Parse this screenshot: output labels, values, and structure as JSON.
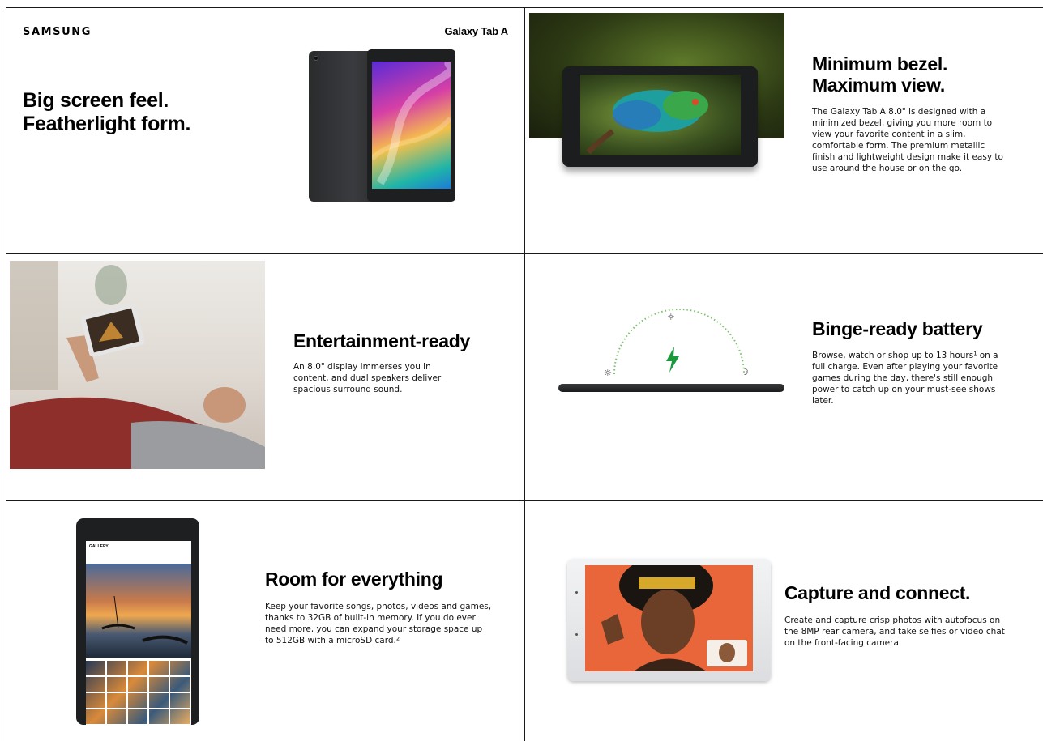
{
  "hero": {
    "brand": "SAMSUNG",
    "model": "Galaxy Tab A",
    "headline_line1": "Big screen feel.",
    "headline_line2": "Featherlight form."
  },
  "bezel": {
    "headline_line1": "Minimum bezel.",
    "headline_line2": "Maximum view.",
    "body": "The Galaxy Tab A 8.0\" is designed with a minimized bezel, giving you more room to view your favorite content in a slim, comfortable form. The premium metallic finish and lightweight design make it easy to use around the house or on the go."
  },
  "entertainment": {
    "headline": "Entertainment-ready",
    "body": "An 8.0\" display immerses you in content, and dual speakers deliver spacious surround sound."
  },
  "battery": {
    "headline": "Binge-ready battery",
    "body": "Browse, watch or shop up to 13 hours¹ on a full charge. Even after playing your favorite games during the day, there's still enough power to catch up on your must-see shows later.",
    "icons": [
      "sunrise-icon",
      "sun-icon",
      "lightning-bolt-icon",
      "moon-icon"
    ]
  },
  "storage": {
    "headline": "Room for everything",
    "body": "Keep your favorite songs, photos, videos and games, thanks to 32GB of built-in memory. If you do ever need more, you can expand your storage space up to 512GB with a microSD card.²",
    "screen_app_label": "GALLERY"
  },
  "camera": {
    "headline": "Capture and connect.",
    "body": "Create and capture crisp photos with autofocus on the 8MP rear camera, and take selfies or video chat on the front-facing camera."
  },
  "colors": {
    "border": "#1a1a1a",
    "bolt_green": "#1a9a3c",
    "arc_green": "#7cc26b",
    "tablet_black": "#1e1f21",
    "tablet_silver": "#e6e7e9"
  }
}
